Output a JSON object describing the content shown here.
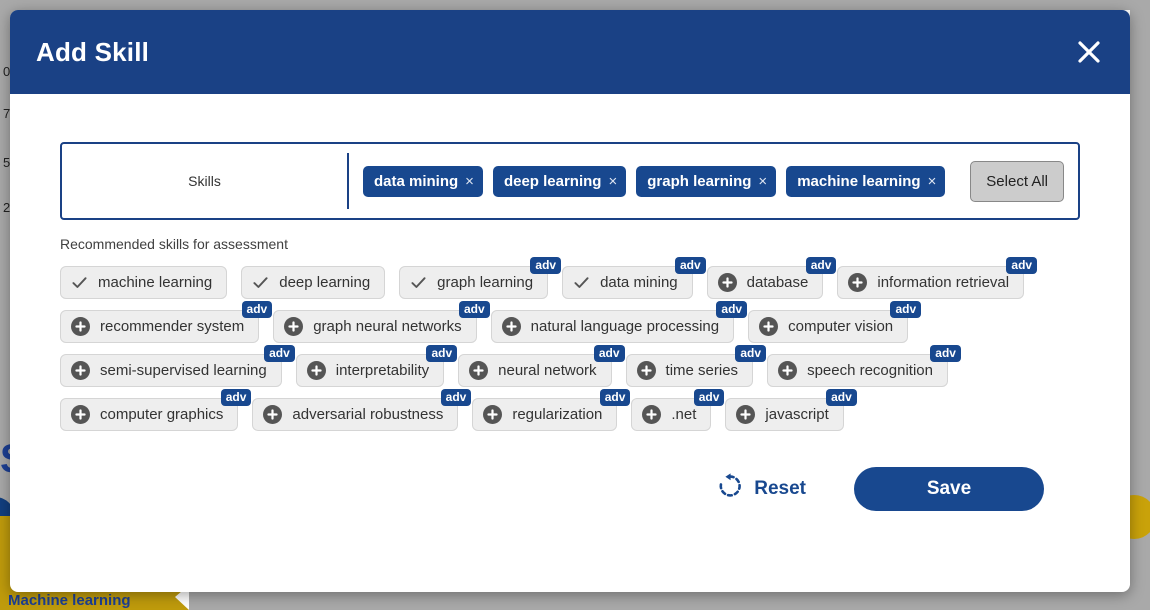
{
  "background": {
    "axis_labels": [
      "0",
      "7",
      "5",
      "2"
    ],
    "partial_heading": "S",
    "bottom_banner_label": "Machine learning"
  },
  "modal": {
    "title": "Add Skill",
    "close_icon": "close-icon",
    "skills_field": {
      "label": "Skills",
      "selected": [
        {
          "label": "data mining",
          "remove": "×"
        },
        {
          "label": "deep learning",
          "remove": "×"
        },
        {
          "label": "graph learning",
          "remove": "×"
        },
        {
          "label": "machine learning",
          "remove": "×"
        }
      ],
      "select_all_label": "Select All"
    },
    "recommended": {
      "caption": "Recommended skills for assessment",
      "badge_label": "adv",
      "items": [
        {
          "label": "machine learning",
          "state": "selected",
          "icon": "check-icon",
          "badge": false
        },
        {
          "label": "deep learning",
          "state": "selected",
          "icon": "check-icon",
          "badge": false
        },
        {
          "label": "graph learning",
          "state": "selected",
          "icon": "check-icon",
          "badge": true
        },
        {
          "label": "data mining",
          "state": "selected",
          "icon": "check-icon",
          "badge": true
        },
        {
          "label": "database",
          "state": "unselected",
          "icon": "plus-circle-icon",
          "badge": true
        },
        {
          "label": "information retrieval",
          "state": "unselected",
          "icon": "plus-circle-icon",
          "badge": true
        },
        {
          "label": "recommender system",
          "state": "unselected",
          "icon": "plus-circle-icon",
          "badge": true
        },
        {
          "label": "graph neural networks",
          "state": "unselected",
          "icon": "plus-circle-icon",
          "badge": true
        },
        {
          "label": "natural language processing",
          "state": "unselected",
          "icon": "plus-circle-icon",
          "badge": true
        },
        {
          "label": "computer vision",
          "state": "unselected",
          "icon": "plus-circle-icon",
          "badge": true
        },
        {
          "label": "semi-supervised learning",
          "state": "unselected",
          "icon": "plus-circle-icon",
          "badge": true
        },
        {
          "label": "interpretability",
          "state": "unselected",
          "icon": "plus-circle-icon",
          "badge": true
        },
        {
          "label": "neural network",
          "state": "unselected",
          "icon": "plus-circle-icon",
          "badge": true
        },
        {
          "label": "time series",
          "state": "unselected",
          "icon": "plus-circle-icon",
          "badge": true
        },
        {
          "label": "speech recognition",
          "state": "unselected",
          "icon": "plus-circle-icon",
          "badge": true
        },
        {
          "label": "computer graphics",
          "state": "unselected",
          "icon": "plus-circle-icon",
          "badge": true
        },
        {
          "label": "adversarial robustness",
          "state": "unselected",
          "icon": "plus-circle-icon",
          "badge": true
        },
        {
          "label": "regularization",
          "state": "unselected",
          "icon": "plus-circle-icon",
          "badge": true
        },
        {
          "label": ".net",
          "state": "unselected",
          "icon": "plus-circle-icon",
          "badge": true
        },
        {
          "label": "javascript",
          "state": "unselected",
          "icon": "plus-circle-icon",
          "badge": true
        }
      ]
    },
    "footer": {
      "reset_label": "Reset",
      "reset_icon": "rotate-ccw-icon",
      "save_label": "Save"
    }
  },
  "colors": {
    "brand_blue": "#18488f",
    "header_blue": "#1a4185",
    "chip_grey": "#eeeeee",
    "gold": "#bf9b0c",
    "backdrop_grey": "#a9a9a9"
  }
}
